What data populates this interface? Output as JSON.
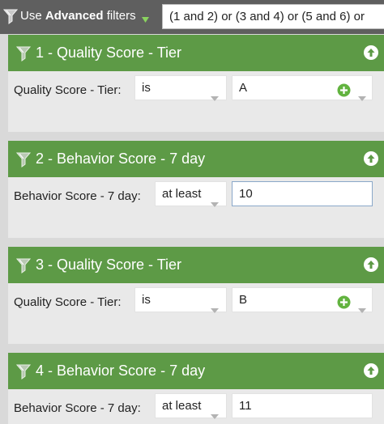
{
  "topbar": {
    "prefix": "Use",
    "bold": "Advanced",
    "suffix": "filters",
    "logic": "(1 and 2) or (3 and 4) or (5 and 6) or"
  },
  "filters": [
    {
      "title": "1 - Quality Score - Tier",
      "label": "Quality Score - Tier:",
      "operator": "is",
      "value": "A"
    },
    {
      "title": "2 - Behavior Score - 7 day",
      "label": "Behavior Score - 7 day:",
      "operator": "at least",
      "value": "10"
    },
    {
      "title": "3 - Quality Score - Tier",
      "label": "Quality Score - Tier:",
      "operator": "is",
      "value": "B"
    },
    {
      "title": "4 - Behavior Score - 7 day",
      "label": "Behavior Score - 7 day:",
      "operator": "at least",
      "value": "11"
    }
  ],
  "colors": {
    "header_green": "#5d9a46",
    "topbar_gray": "#5f5f5f",
    "plus_green": "#62b33f"
  }
}
